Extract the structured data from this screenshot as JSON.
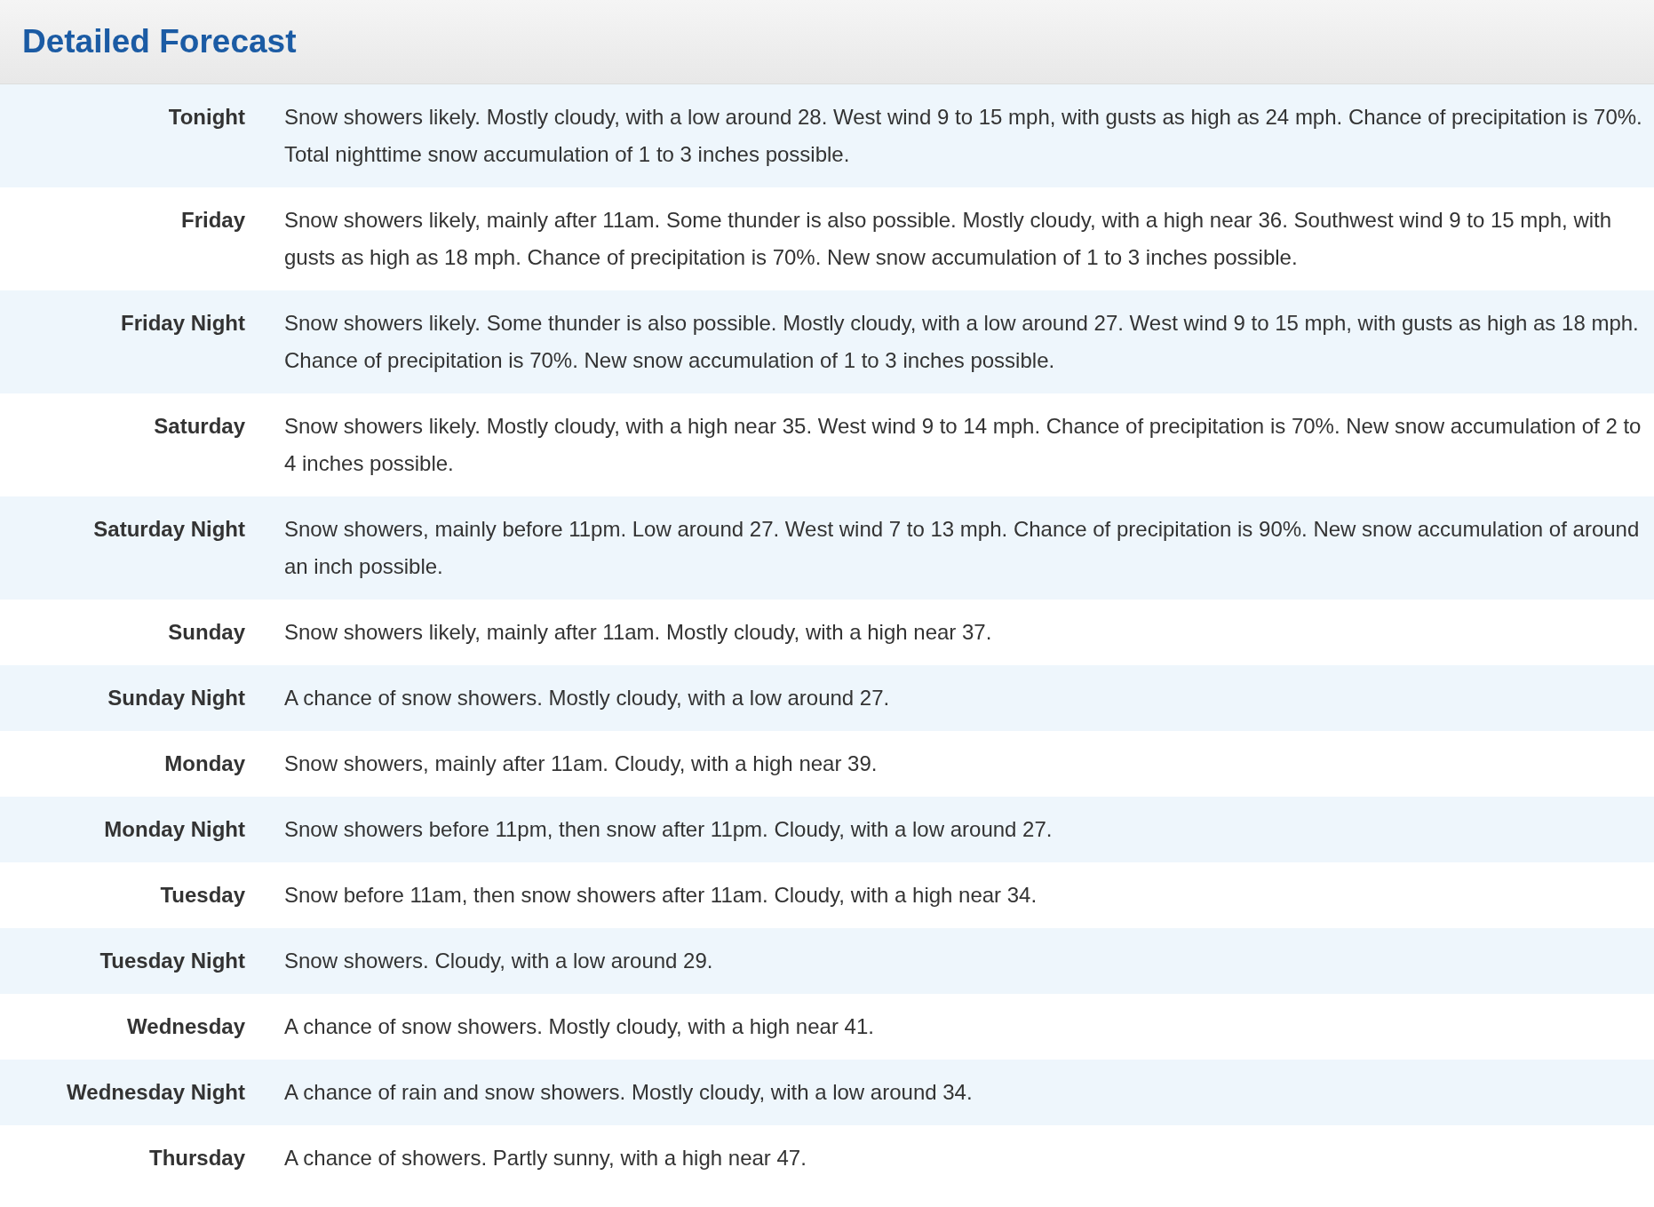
{
  "panel": {
    "title": "Detailed Forecast"
  },
  "rows": [
    {
      "period": "Tonight",
      "text": "Snow showers likely. Mostly cloudy, with a low around 28. West wind 9 to 15 mph, with gusts as high as 24 mph. Chance of precipitation is 70%. Total nighttime snow accumulation of 1 to 3 inches possible."
    },
    {
      "period": "Friday",
      "text": "Snow showers likely, mainly after 11am. Some thunder is also possible. Mostly cloudy, with a high near 36. Southwest wind 9 to 15 mph, with gusts as high as 18 mph. Chance of precipitation is 70%. New snow accumulation of 1 to 3 inches possible."
    },
    {
      "period": "Friday Night",
      "text": "Snow showers likely. Some thunder is also possible. Mostly cloudy, with a low around 27. West wind 9 to 15 mph, with gusts as high as 18 mph. Chance of precipitation is 70%. New snow accumulation of 1 to 3 inches possible."
    },
    {
      "period": "Saturday",
      "text": "Snow showers likely. Mostly cloudy, with a high near 35. West wind 9 to 14 mph. Chance of precipitation is 70%. New snow accumulation of 2 to 4 inches possible."
    },
    {
      "period": "Saturday Night",
      "text": "Snow showers, mainly before 11pm. Low around 27. West wind 7 to 13 mph. Chance of precipitation is 90%. New snow accumulation of around an inch possible."
    },
    {
      "period": "Sunday",
      "text": "Snow showers likely, mainly after 11am. Mostly cloudy, with a high near 37."
    },
    {
      "period": "Sunday Night",
      "text": "A chance of snow showers. Mostly cloudy, with a low around 27."
    },
    {
      "period": "Monday",
      "text": "Snow showers, mainly after 11am. Cloudy, with a high near 39."
    },
    {
      "period": "Monday Night",
      "text": "Snow showers before 11pm, then snow after 11pm. Cloudy, with a low around 27."
    },
    {
      "period": "Tuesday",
      "text": "Snow before 11am, then snow showers after 11am. Cloudy, with a high near 34."
    },
    {
      "period": "Tuesday Night",
      "text": "Snow showers. Cloudy, with a low around 29."
    },
    {
      "period": "Wednesday",
      "text": "A chance of snow showers. Mostly cloudy, with a high near 41."
    },
    {
      "period": "Wednesday Night",
      "text": "A chance of rain and snow showers. Mostly cloudy, with a low around 34."
    },
    {
      "period": "Thursday",
      "text": "A chance of showers. Partly sunny, with a high near 47."
    }
  ]
}
